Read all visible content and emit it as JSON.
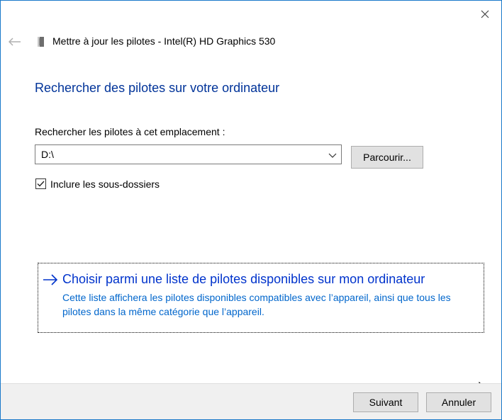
{
  "window": {
    "title": "Mettre à jour les pilotes - Intel(R) HD Graphics 530"
  },
  "icons": {
    "close": "close-icon",
    "back": "back-arrow-icon",
    "device": "display-adapter-icon",
    "combo": "chevron-down-icon",
    "check": "checkmark-icon",
    "option_arrow": "arrow-right-icon",
    "cursor": "mouse-pointer-icon"
  },
  "main": {
    "heading": "Rechercher des pilotes sur votre ordinateur",
    "location_label": "Rechercher les pilotes à cet emplacement :",
    "location_value": "D:\\",
    "browse_label": "Parcourir...",
    "include_subfolders_label": "Inclure les sous-dossiers",
    "include_subfolders_checked": true
  },
  "option": {
    "title": "Choisir parmi une liste de pilotes disponibles sur mon ordinateur",
    "description": "Cette liste affichera les pilotes disponibles compatibles avec l’appareil, ainsi que tous les pilotes dans la même catégorie que l’appareil."
  },
  "footer": {
    "next_label": "Suivant",
    "cancel_label": "Annuler"
  },
  "colors": {
    "window_border": "#1979ca",
    "heading": "#003399",
    "link_title": "#0033cc",
    "link_desc": "#0066cc",
    "footer_bg": "#f0f0f0"
  }
}
